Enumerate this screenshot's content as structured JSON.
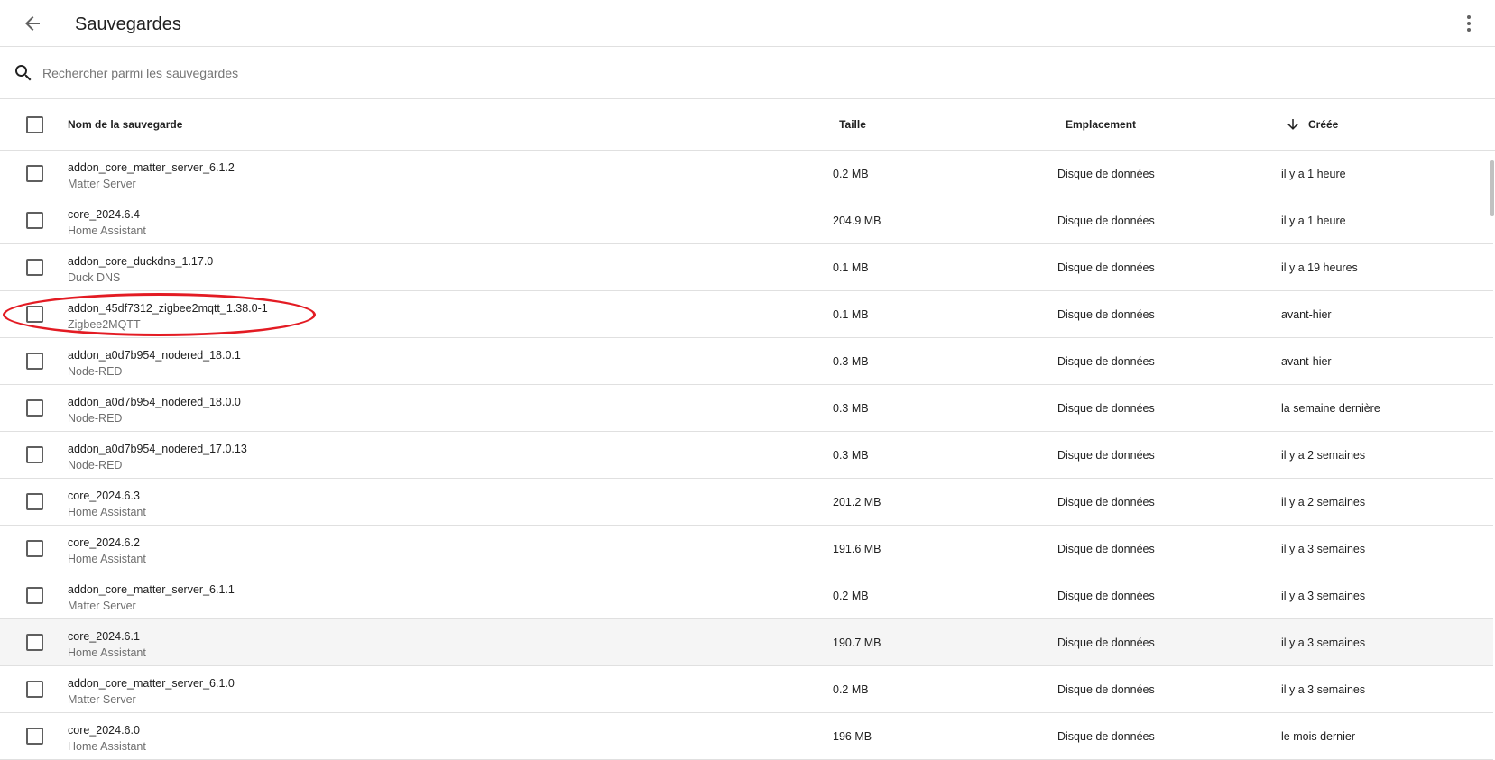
{
  "header": {
    "title": "Sauvegardes"
  },
  "search": {
    "placeholder": "Rechercher parmi les sauvegardes",
    "value": ""
  },
  "table": {
    "columns": {
      "name": "Nom de la sauvegarde",
      "size": "Taille",
      "location": "Emplacement",
      "created": "Créée"
    },
    "sort": {
      "column": "created",
      "direction": "descending"
    },
    "rows": [
      {
        "name": "addon_core_matter_server_6.1.2",
        "sub": "Matter Server",
        "size": "0.2 MB",
        "location": "Disque de données",
        "created": "il y a 1 heure"
      },
      {
        "name": "core_2024.6.4",
        "sub": "Home Assistant",
        "size": "204.9 MB",
        "location": "Disque de données",
        "created": "il y a 1 heure"
      },
      {
        "name": "addon_core_duckdns_1.17.0",
        "sub": "Duck DNS",
        "size": "0.1 MB",
        "location": "Disque de données",
        "created": "il y a 19 heures"
      },
      {
        "name": "addon_45df7312_zigbee2mqtt_1.38.0-1",
        "sub": "Zigbee2MQTT",
        "size": "0.1 MB",
        "location": "Disque de données",
        "created": "avant-hier"
      },
      {
        "name": "addon_a0d7b954_nodered_18.0.1",
        "sub": "Node-RED",
        "size": "0.3 MB",
        "location": "Disque de données",
        "created": "avant-hier"
      },
      {
        "name": "addon_a0d7b954_nodered_18.0.0",
        "sub": "Node-RED",
        "size": "0.3 MB",
        "location": "Disque de données",
        "created": "la semaine dernière"
      },
      {
        "name": "addon_a0d7b954_nodered_17.0.13",
        "sub": "Node-RED",
        "size": "0.3 MB",
        "location": "Disque de données",
        "created": "il y a 2 semaines"
      },
      {
        "name": "core_2024.6.3",
        "sub": "Home Assistant",
        "size": "201.2 MB",
        "location": "Disque de données",
        "created": "il y a 2 semaines"
      },
      {
        "name": "core_2024.6.2",
        "sub": "Home Assistant",
        "size": "191.6 MB",
        "location": "Disque de données",
        "created": "il y a 3 semaines"
      },
      {
        "name": "addon_core_matter_server_6.1.1",
        "sub": "Matter Server",
        "size": "0.2 MB",
        "location": "Disque de données",
        "created": "il y a 3 semaines"
      },
      {
        "name": "core_2024.6.1",
        "sub": "Home Assistant",
        "size": "190.7 MB",
        "location": "Disque de données",
        "created": "il y a 3 semaines"
      },
      {
        "name": "addon_core_matter_server_6.1.0",
        "sub": "Matter Server",
        "size": "0.2 MB",
        "location": "Disque de données",
        "created": "il y a 3 semaines"
      },
      {
        "name": "core_2024.6.0",
        "sub": "Home Assistant",
        "size": "196 MB",
        "location": "Disque de données",
        "created": "le mois dernier"
      }
    ]
  },
  "icons": {
    "back": "arrow-left-icon",
    "menu": "dots-vertical-icon",
    "search": "magnify-icon",
    "sort": "arrow-down-icon"
  },
  "colors": {
    "annotation": "#e31b23",
    "divider": "#e0e0e0",
    "row_hover": "#f5f5f5"
  }
}
